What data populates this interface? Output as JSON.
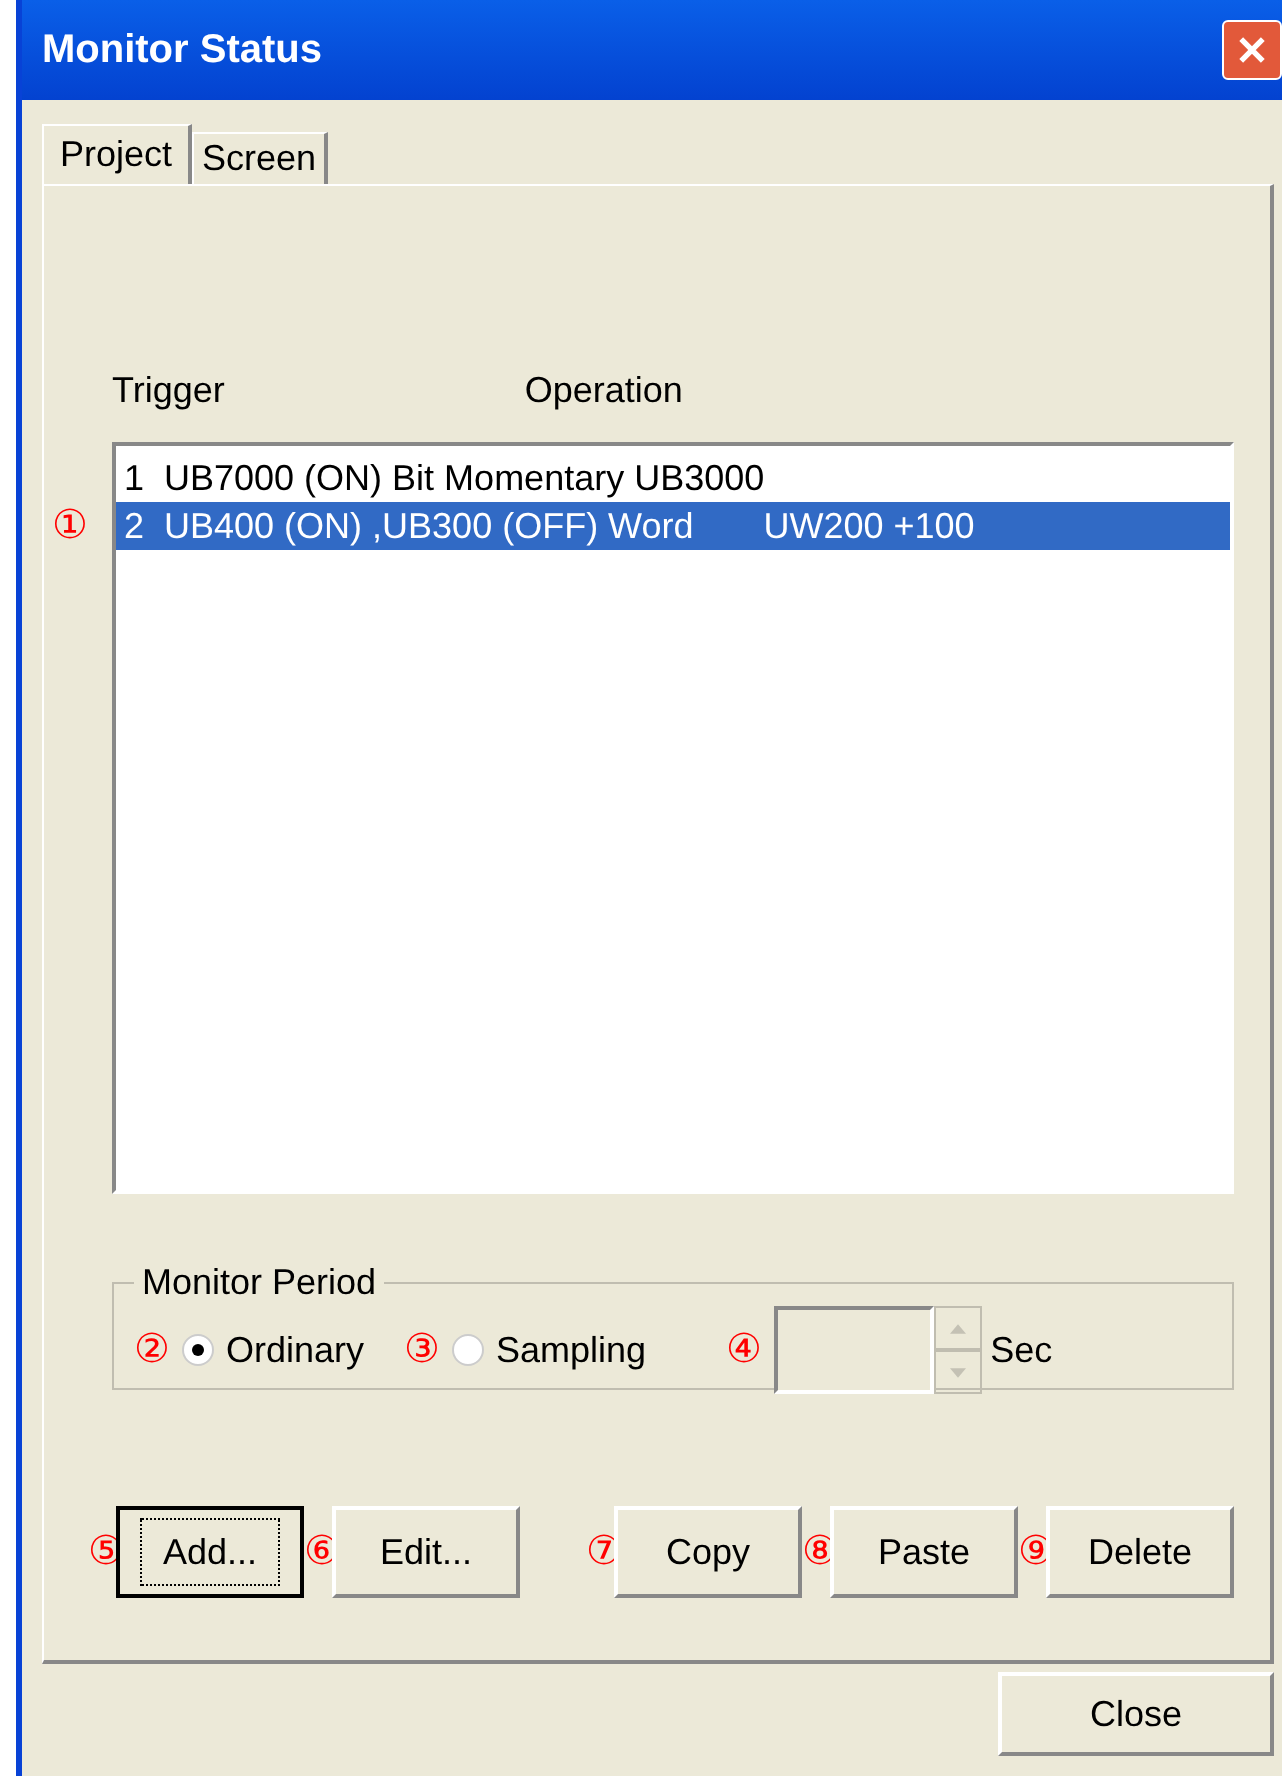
{
  "window": {
    "title": "Monitor Status"
  },
  "tabs": [
    {
      "label": "Project",
      "selected": true
    },
    {
      "label": "Screen",
      "selected": false
    }
  ],
  "list": {
    "columns": [
      "Trigger",
      "Operation"
    ],
    "rows": [
      {
        "text": "1  UB7000 (ON) Bit Momentary UB3000",
        "selected": false
      },
      {
        "text": "2  UB400 (ON) ,UB300 (OFF) Word       UW200 +100",
        "selected": true,
        "callout": "①"
      }
    ]
  },
  "monitor_period": {
    "title": "Monitor Period",
    "options": [
      {
        "label": "Ordinary",
        "selected": true,
        "callout": "②"
      },
      {
        "label": "Sampling",
        "selected": false,
        "callout": "③"
      }
    ],
    "spinner": {
      "callout": "④",
      "unit": "Sec",
      "disabled": true
    }
  },
  "buttons": [
    {
      "label": "Add...",
      "callout": "⑤",
      "focused": true
    },
    {
      "label": "Edit...",
      "callout": "⑥",
      "focused": false
    },
    {
      "label": "Copy",
      "callout": "⑦",
      "focused": false
    },
    {
      "label": "Paste",
      "callout": "⑧",
      "focused": false
    },
    {
      "label": "Delete",
      "callout": "⑨",
      "focused": false
    }
  ],
  "close_button": "Close"
}
